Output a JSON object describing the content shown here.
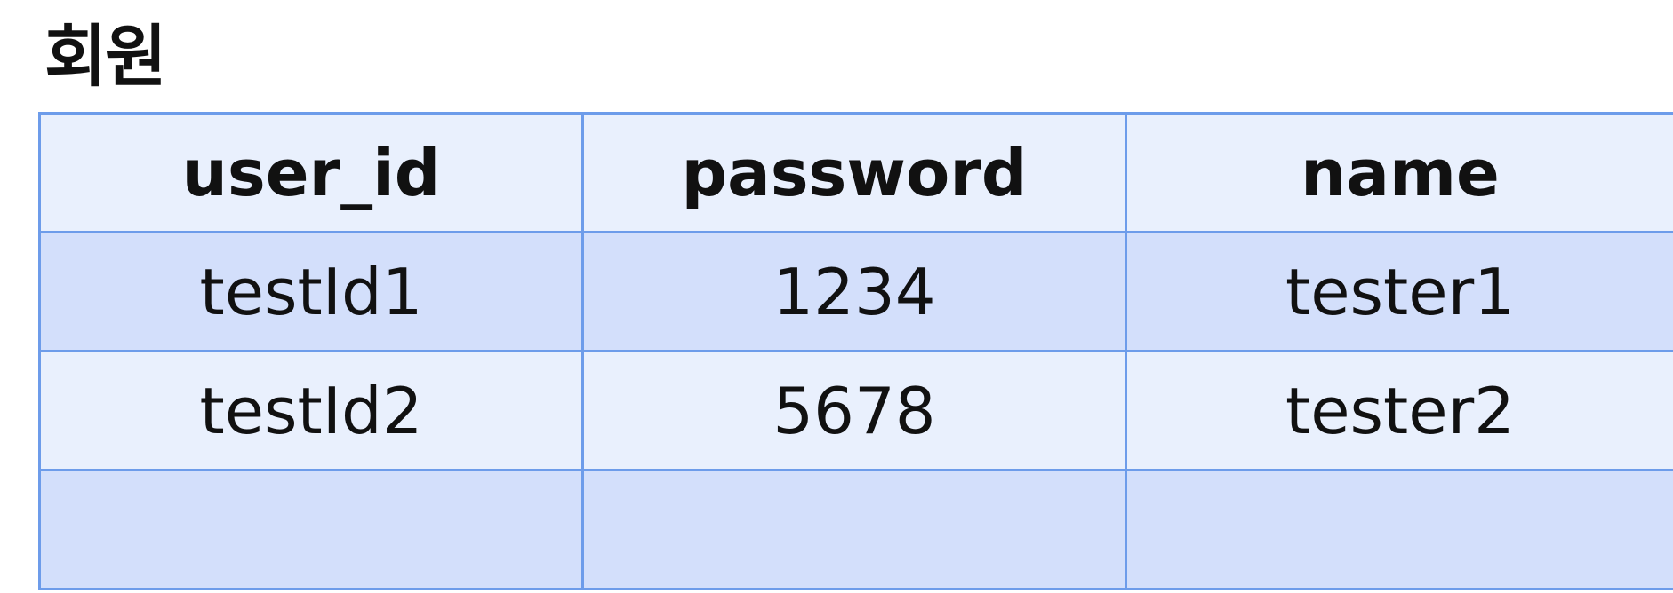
{
  "title": "회원",
  "table": {
    "columns": [
      "user_id",
      "password",
      "name"
    ],
    "rows": [
      [
        "testId1",
        "1234",
        "tester1"
      ],
      [
        "testId2",
        "5678",
        "tester2"
      ],
      [
        "",
        "",
        ""
      ]
    ]
  },
  "colors": {
    "border": "#6d9cea",
    "header_bg": "#e9f0fd",
    "row_dark": "#d3dffb",
    "row_light": "#e9f0fd"
  }
}
